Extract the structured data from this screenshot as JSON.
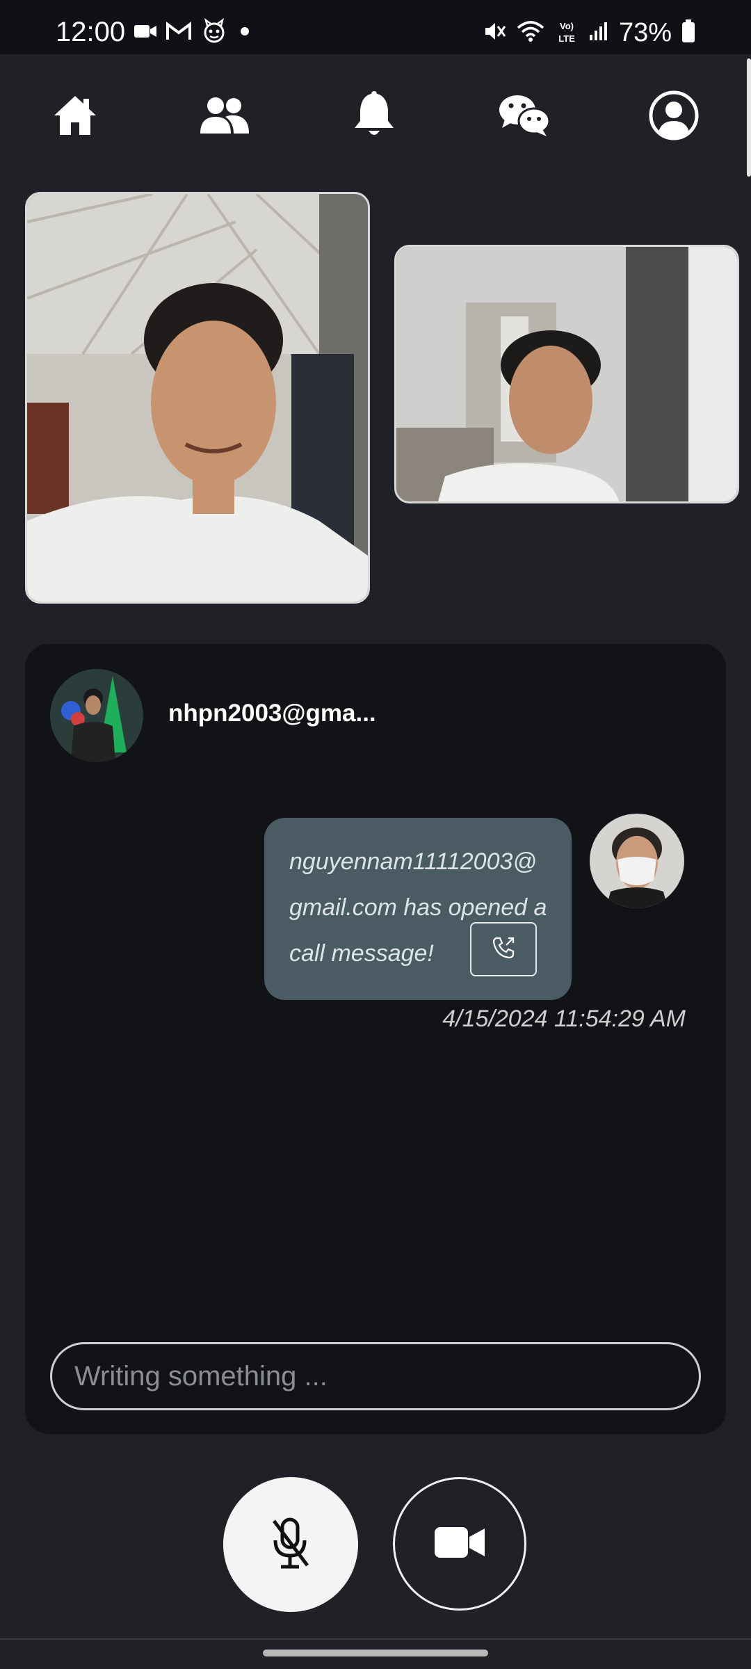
{
  "status_bar": {
    "time": "12:00",
    "battery": "73%",
    "icons_left": [
      "video-call-icon",
      "gmail-icon",
      "app-icon",
      "dot-icon"
    ],
    "icons_right": [
      "mute-icon",
      "wifi-icon",
      "volte-icon",
      "signal-icon",
      "battery-icon"
    ]
  },
  "nav": {
    "items": [
      "home-icon",
      "friends-icon",
      "bell-icon",
      "chat-icon",
      "profile-icon"
    ]
  },
  "chat": {
    "contact_name": "nhpn2003@gma...",
    "message": {
      "text": "nguyennam11112003@ gmail.com has opened a call message!",
      "timestamp": "4/15/2024 11:54:29 AM"
    },
    "input_placeholder": "Writing something ..."
  },
  "controls": {
    "mic": "mic-off-icon",
    "camera": "video-camera-icon"
  },
  "colors": {
    "background": "#1f2127",
    "panel": "#121316",
    "bubble": "#4b5b63",
    "status_bar": "#0f1116"
  }
}
